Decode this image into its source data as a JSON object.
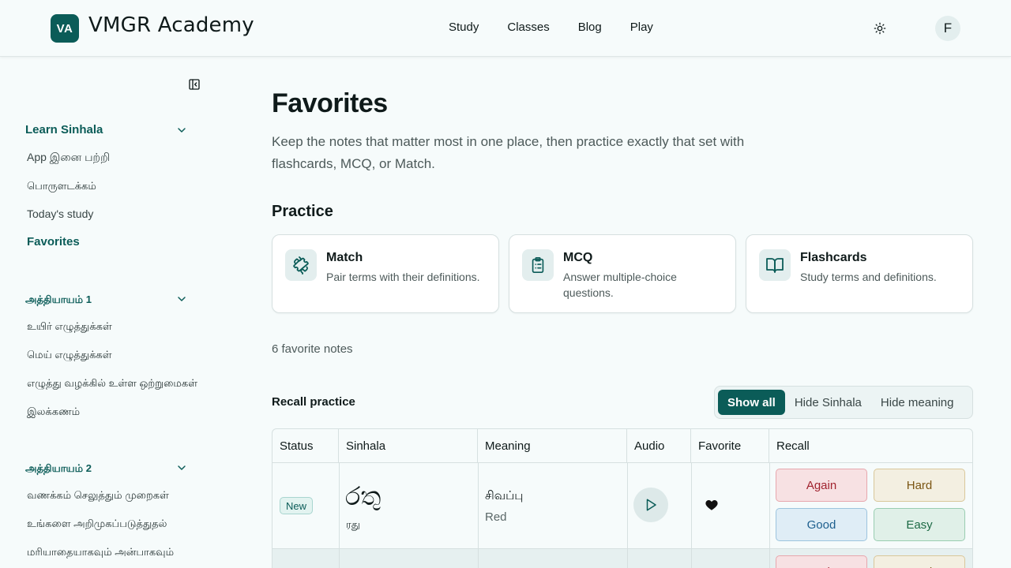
{
  "header": {
    "logo_initials": "VA",
    "brand": "VMGR Academy",
    "nav": [
      "Study",
      "Classes",
      "Blog",
      "Play"
    ],
    "avatar_initial": "F"
  },
  "sidebar": {
    "section1": {
      "title": "Learn Sinhala",
      "items": [
        "App இனை பற்றி",
        "பொருளடக்கம்",
        "Today's study",
        "Favorites"
      ],
      "active": "Favorites"
    },
    "section2": {
      "title": "அத்தியாயம் 1",
      "items": [
        "உயிர் எழுத்துக்கள்",
        "மெய் எழுத்துக்கள்",
        "எழுத்து வழக்கில் உள்ள ஒற்றுமைகள்",
        "இலக்கணம்"
      ]
    },
    "section3": {
      "title": "அத்தியாயம் 2",
      "items": [
        "வணக்கம் செலுத்தும் முறைகள்",
        "உங்களை அறிமுகப்படுத்துதல்",
        "மரியாதையாகவும் அன்பாகவும்"
      ]
    }
  },
  "main": {
    "title": "Favorites",
    "description": "Keep the notes that matter most in one place, then practice exactly that set with flashcards, MCQ, or Match.",
    "practice_heading": "Practice",
    "cards": [
      {
        "title": "Match",
        "desc": "Pair terms with their definitions.",
        "icon": "puzzle-icon"
      },
      {
        "title": "MCQ",
        "desc": "Answer multiple-choice questions.",
        "icon": "clipboard-list-icon"
      },
      {
        "title": "Flashcards",
        "desc": "Study terms and definitions.",
        "icon": "book-open-icon"
      }
    ],
    "count_text": "6 favorite notes",
    "recall_label": "Recall practice",
    "toggle": {
      "options": [
        "Show all",
        "Hide Sinhala",
        "Hide meaning"
      ],
      "selected": "Show all"
    }
  },
  "table": {
    "headers": [
      "Status",
      "Sinhala",
      "Meaning",
      "Audio",
      "Favorite",
      "Recall"
    ],
    "rows": [
      {
        "status": "New",
        "sinhala": "රතු",
        "transliteration": "ரது",
        "meaning": "சிவப்பு",
        "meaning_en": "Red",
        "favorite": true
      }
    ],
    "recall_buttons": [
      "Again",
      "Hard",
      "Good",
      "Easy"
    ]
  },
  "colors": {
    "accent": "#0b5c58",
    "background": "#f6fbfb",
    "again": "#a1232f",
    "hard": "#7a5512",
    "good": "#1d5f8e",
    "easy": "#1d6a45"
  }
}
